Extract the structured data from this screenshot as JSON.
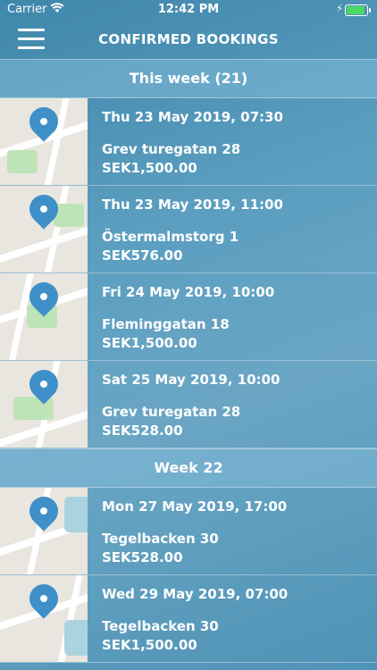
{
  "status": {
    "carrier": "Carrier",
    "time": "12:42 PM"
  },
  "nav": {
    "title": "CONFIRMED BOOKINGS"
  },
  "sections": [
    {
      "title": "This week (21)",
      "bookings": [
        {
          "date": "Thu 23 May 2019, 07:30",
          "address": "Grev turegatan 28",
          "price": "SEK1,500.00"
        },
        {
          "date": "Thu 23 May 2019, 11:00",
          "address": "Östermalmstorg 1",
          "price": "SEK576.00"
        },
        {
          "date": "Fri 24 May 2019, 10:00",
          "address": "Fleminggatan 18",
          "price": "SEK1,500.00"
        },
        {
          "date": "Sat 25 May 2019, 10:00",
          "address": "Grev turegatan 28",
          "price": "SEK528.00"
        }
      ]
    },
    {
      "title": "Week 22",
      "bookings": [
        {
          "date": "Mon 27 May 2019, 17:00",
          "address": "Tegelbacken 30",
          "price": "SEK528.00"
        },
        {
          "date": "Wed 29 May 2019, 07:00",
          "address": "Tegelbacken 30",
          "price": "SEK1,500.00"
        }
      ]
    }
  ]
}
